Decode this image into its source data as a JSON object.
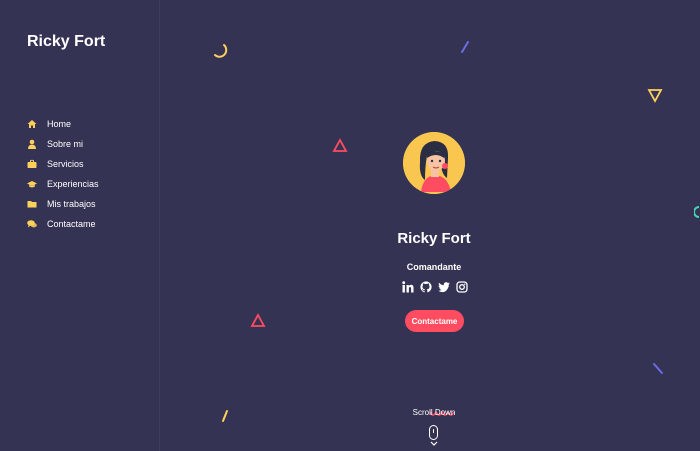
{
  "brand": {
    "name": "Ricky Fort"
  },
  "nav": {
    "items": [
      {
        "label": "Home",
        "icon": "home-icon"
      },
      {
        "label": "Sobre mi",
        "icon": "user-icon"
      },
      {
        "label": "Servicios",
        "icon": "briefcase-icon"
      },
      {
        "label": "Experiencias",
        "icon": "graduation-cap-icon"
      },
      {
        "label": "Mis trabajos",
        "icon": "folder-icon"
      },
      {
        "label": "Contactame",
        "icon": "comments-icon"
      }
    ]
  },
  "hero": {
    "name": "Ricky Fort",
    "role": "Comandante",
    "cta_label": "Contactame",
    "scroll_label": "Scroll Down"
  },
  "socials": [
    "linkedin-icon",
    "github-icon",
    "twitter-icon",
    "instagram-icon"
  ],
  "colors": {
    "background": "#353353",
    "accent": "#ff4c60",
    "icon_yellow": "#ffd15c",
    "shape_purple": "#6c6ce5"
  }
}
